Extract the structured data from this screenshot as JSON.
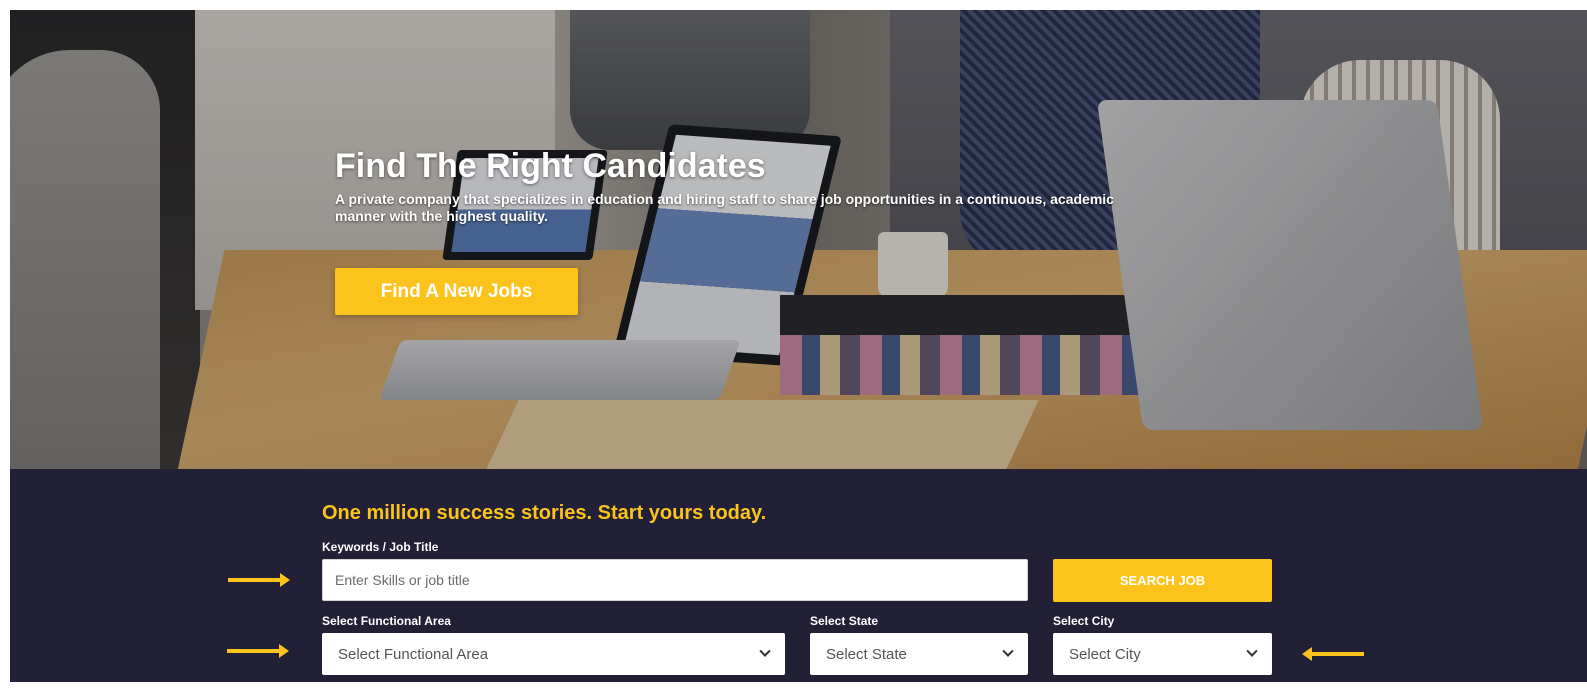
{
  "hero": {
    "title": "Find The Right Candidates",
    "subtitle": "A private company that specializes in education and hiring staff to share job opportunities in a continuous, academic manner with the highest quality.",
    "cta_label": "Find A New Jobs"
  },
  "search": {
    "tagline": "One million success stories. Start yours today.",
    "keywords_label": "Keywords / Job Title",
    "keywords_placeholder": "Enter Skills or job title",
    "search_button": "SEARCH JOB",
    "functional_area_label": "Select Functional Area",
    "functional_area_value": "Select Functional Area",
    "state_label": "Select State",
    "state_value": "Select State",
    "city_label": "Select City",
    "city_value": "Select City"
  },
  "colors": {
    "accent": "#fbc31c",
    "panel_bg": "#212036",
    "text_light": "#ffffff"
  },
  "icons": {
    "dropdown": "chevron-down-icon",
    "pointer": "arrow-icon"
  }
}
